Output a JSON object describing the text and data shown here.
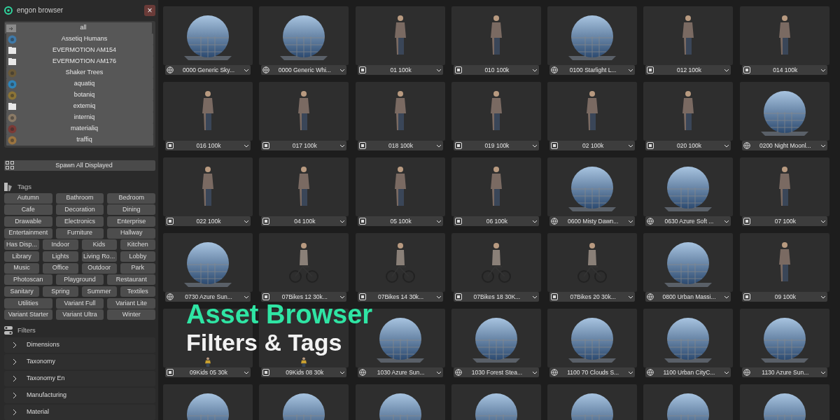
{
  "window": {
    "title": "engon browser",
    "close": "×"
  },
  "libraries": [
    {
      "label": "all",
      "kind": "all"
    },
    {
      "label": "Assetiq Humans",
      "kind": "emblem",
      "color": "#3f79a8"
    },
    {
      "label": "EVERMOTION AM154",
      "kind": "folder"
    },
    {
      "label": "EVERMOTION AM176",
      "kind": "folder"
    },
    {
      "label": "Shaker Trees",
      "kind": "emblem",
      "color": "#6b5a38"
    },
    {
      "label": "aquatiq",
      "kind": "emblem",
      "color": "#2f84b8"
    },
    {
      "label": "botaniq",
      "kind": "emblem",
      "color": "#8c7436"
    },
    {
      "label": "extemiq",
      "kind": "folder"
    },
    {
      "label": "interniq",
      "kind": "emblem",
      "color": "#8a7a66"
    },
    {
      "label": "materialiq",
      "kind": "emblem",
      "color": "#7a3a36"
    },
    {
      "label": "traffiq",
      "kind": "emblem",
      "color": "#9a7440"
    }
  ],
  "spawn_button": "Spawn All Displayed",
  "tags": {
    "title": "Tags",
    "rows": [
      [
        "Autumn",
        "Bathroom",
        "Bedroom"
      ],
      [
        "Cafe",
        "Decoration",
        "Dining"
      ],
      [
        "Drawable",
        "Electronics",
        "Enterprise"
      ],
      [
        "Entertainment",
        "Furniture",
        "Hallway"
      ],
      [
        "Has Disp...",
        "Indoor",
        "Kids",
        "Kitchen"
      ],
      [
        "Library",
        "Lights",
        "Living Ro...",
        "Lobby"
      ],
      [
        "Music",
        "Office",
        "Outdoor",
        "Park"
      ],
      [
        "Photoscan",
        "Playground",
        "Restaurant"
      ],
      [
        "Sanitary",
        "Spring",
        "Summer",
        "Textiles"
      ],
      [
        "Utilities",
        "Variant Full",
        "Variant Lite"
      ],
      [
        "Variant Starter",
        "Variant Ultra",
        "Winter"
      ]
    ]
  },
  "filters": {
    "title": "Filters",
    "items": [
      {
        "label": "Dimensions",
        "expanded": false
      },
      {
        "label": "Taxonomy",
        "expanded": false
      },
      {
        "label": "Taxonomy En",
        "expanded": false
      },
      {
        "label": "Manufacturing",
        "expanded": false
      },
      {
        "label": "Material",
        "expanded": false
      }
    ]
  },
  "assets": [
    {
      "label": "0000 Generic Sky...",
      "hdri": true,
      "kind": "sky"
    },
    {
      "label": "0000 Generic Whi...",
      "hdri": true,
      "kind": "white"
    },
    {
      "label": "01 100k",
      "hdri": false,
      "kind": "person"
    },
    {
      "label": "010 100k",
      "hdri": false,
      "kind": "person"
    },
    {
      "label": "0100 Starlight L...",
      "hdri": true,
      "kind": "dark"
    },
    {
      "label": "012 100k",
      "hdri": false,
      "kind": "person"
    },
    {
      "label": "014 100k",
      "hdri": false,
      "kind": "person"
    },
    {
      "label": "016 100k",
      "hdri": false,
      "kind": "person"
    },
    {
      "label": "017 100k",
      "hdri": false,
      "kind": "person"
    },
    {
      "label": "018 100k",
      "hdri": false,
      "kind": "person"
    },
    {
      "label": "019 100k",
      "hdri": false,
      "kind": "person"
    },
    {
      "label": "02 100k",
      "hdri": false,
      "kind": "person"
    },
    {
      "label": "020 100k",
      "hdri": false,
      "kind": "person"
    },
    {
      "label": "0200 Night Moonl...",
      "hdri": true,
      "kind": "dark"
    },
    {
      "label": "022 100k",
      "hdri": false,
      "kind": "person"
    },
    {
      "label": "04 100k",
      "hdri": false,
      "kind": "person"
    },
    {
      "label": "05 100k",
      "hdri": false,
      "kind": "person"
    },
    {
      "label": "06 100k",
      "hdri": false,
      "kind": "person"
    },
    {
      "label": "0600 Misty Dawn...",
      "hdri": true,
      "kind": "sky"
    },
    {
      "label": "0630 Azure Soft ...",
      "hdri": true,
      "kind": "sky"
    },
    {
      "label": "07 100k",
      "hdri": false,
      "kind": "person"
    },
    {
      "label": "0730 Azure Sun...",
      "hdri": true,
      "kind": "sky"
    },
    {
      "label": "07Bikes 12 30k...",
      "hdri": false,
      "kind": "cyclist"
    },
    {
      "label": "07Bikes 14 30k...",
      "hdri": false,
      "kind": "cyclist"
    },
    {
      "label": "07Bikes 18 30K...",
      "hdri": false,
      "kind": "cyclist"
    },
    {
      "label": "07Bikes 20 30k...",
      "hdri": false,
      "kind": "cyclist"
    },
    {
      "label": "0800 Urban Massi...",
      "hdri": true,
      "kind": "white"
    },
    {
      "label": "09 100k",
      "hdri": false,
      "kind": "person"
    },
    {
      "label": "09Kids 05 30k",
      "hdri": false,
      "kind": "kid"
    },
    {
      "label": "09Kids 08 30k",
      "hdri": false,
      "kind": "kid"
    },
    {
      "label": "1030 Azure Sun...",
      "hdri": true,
      "kind": "sky"
    },
    {
      "label": "1030 Forest Stea...",
      "hdri": true,
      "kind": "white"
    },
    {
      "label": "1100 70 Clouds S...",
      "hdri": true,
      "kind": "sky"
    },
    {
      "label": "1100 Urban CityC...",
      "hdri": true,
      "kind": "sky"
    },
    {
      "label": "1130 Azure Sun...",
      "hdri": true,
      "kind": "sky"
    },
    {
      "kind": "sky"
    },
    {
      "kind": "sky"
    },
    {
      "kind": "sky"
    },
    {
      "kind": "white"
    },
    {
      "kind": "sky"
    },
    {
      "kind": "sky"
    },
    {
      "kind": "white"
    }
  ],
  "caption": {
    "title": "Asset Browser",
    "subtitle": "Filters & Tags"
  }
}
